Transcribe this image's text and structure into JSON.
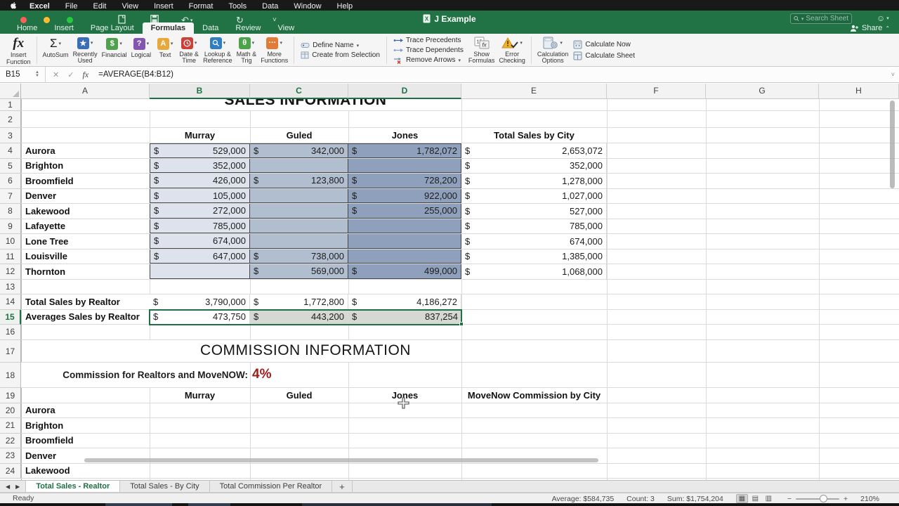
{
  "menu_bar": {
    "items": [
      "Excel",
      "File",
      "Edit",
      "View",
      "Insert",
      "Format",
      "Tools",
      "Data",
      "Window",
      "Help"
    ]
  },
  "title_bar": {
    "title": "J Example",
    "search_placeholder": "Search Sheet",
    "share_label": "Share"
  },
  "ribbon_tabs": [
    {
      "label": "Home",
      "active": false
    },
    {
      "label": "Insert",
      "active": false
    },
    {
      "label": "Page Layout",
      "active": false
    },
    {
      "label": "Formulas",
      "active": true
    },
    {
      "label": "Data",
      "active": false
    },
    {
      "label": "Review",
      "active": false
    },
    {
      "label": "View",
      "active": false
    }
  ],
  "ribbon": {
    "insert_function_label": "Insert\nFunction",
    "function_library": [
      {
        "label": "AutoSum",
        "glyph": "Σ",
        "color": "",
        "icon_name": "autosum-icon"
      },
      {
        "label": "Recently\nUsed",
        "glyph": "★",
        "color": "#3a6fb5",
        "icon_name": "recently-used-icon"
      },
      {
        "label": "Financial",
        "glyph": "$",
        "color": "#4fa14d",
        "icon_name": "financial-icon"
      },
      {
        "label": "Logical",
        "glyph": "?",
        "color": "#8456b0",
        "icon_name": "logical-icon"
      },
      {
        "label": "Text",
        "glyph": "A",
        "color": "#e9a93a",
        "icon_name": "text-icon"
      },
      {
        "label": "Date &\nTime",
        "glyph": "clock",
        "color": "#cc4038",
        "icon_name": "date-time-icon"
      },
      {
        "label": "Lookup &\nReference",
        "glyph": "mag",
        "color": "#2f7ec1",
        "icon_name": "lookup-reference-icon"
      },
      {
        "label": "Math &\nTrig",
        "glyph": "θ",
        "color": "#4ca349",
        "icon_name": "math-trig-icon"
      },
      {
        "label": "More\nFunctions",
        "glyph": "···",
        "color": "#e07b39",
        "icon_name": "more-functions-icon"
      }
    ],
    "defined_names": [
      {
        "label": "Define Name",
        "dropdown": true,
        "icon_name": "define-name-icon"
      },
      {
        "label": "Create from Selection",
        "dropdown": false,
        "icon_name": "create-from-selection-icon"
      }
    ],
    "auditing": [
      {
        "label": "Trace Precedents",
        "dropdown": false,
        "icon_name": "trace-precedents-icon"
      },
      {
        "label": "Trace Dependents",
        "dropdown": false,
        "icon_name": "trace-dependents-icon"
      },
      {
        "label": "Remove Arrows",
        "dropdown": true,
        "icon_name": "remove-arrows-icon"
      }
    ],
    "show_formulas_label": "Show\nFormulas",
    "error_checking_label": "Error\nChecking",
    "calculation_options_label": "Calculation\nOptions",
    "calculate": [
      {
        "label": "Calculate Now",
        "icon_name": "calculate-now-icon"
      },
      {
        "label": "Calculate Sheet",
        "icon_name": "calculate-sheet-icon"
      }
    ]
  },
  "formula_bar": {
    "name_box": "B15",
    "cancel": "✕",
    "enter": "✓",
    "fx": "fx",
    "formula": "=AVERAGE(B4:B12)"
  },
  "grid": {
    "columns": [
      "A",
      "B",
      "C",
      "D",
      "E",
      "F",
      "G",
      "H"
    ],
    "selected_columns": [
      "B",
      "C",
      "D"
    ],
    "selected_row": 15,
    "active_cell": "B15",
    "rows": [
      {
        "n": 1,
        "type": "big-title",
        "title": "SALES INFORMATION"
      },
      {
        "n": 2,
        "type": "empty"
      },
      {
        "n": 3,
        "type": "col-headers",
        "b": "Murray",
        "c": "Guled",
        "d": "Jones",
        "e": "Total Sales by City"
      },
      {
        "n": 4,
        "type": "data",
        "a": "Aurora",
        "b": "529,000",
        "c": "342,000",
        "d": "1,782,072",
        "e": "2,653,072"
      },
      {
        "n": 5,
        "type": "data",
        "a": "Brighton",
        "b": "352,000",
        "c": "",
        "d": "",
        "e": "352,000"
      },
      {
        "n": 6,
        "type": "data",
        "a": "Broomfield",
        "b": "426,000",
        "c": "123,800",
        "d": "728,200",
        "e": "1,278,000"
      },
      {
        "n": 7,
        "type": "data",
        "a": "Denver",
        "b": "105,000",
        "c": "",
        "d": "922,000",
        "e": "1,027,000"
      },
      {
        "n": 8,
        "type": "data",
        "a": "Lakewood",
        "b": "272,000",
        "c": "",
        "d": "255,000",
        "e": "527,000"
      },
      {
        "n": 9,
        "type": "data",
        "a": "Lafayette",
        "b": "785,000",
        "c": "",
        "d": "",
        "e": "785,000"
      },
      {
        "n": 10,
        "type": "data",
        "a": "Lone Tree",
        "b": "674,000",
        "c": "",
        "d": "",
        "e": "674,000"
      },
      {
        "n": 11,
        "type": "data",
        "a": "Louisville",
        "b": "647,000",
        "c": "738,000",
        "d": "",
        "e": "1,385,000"
      },
      {
        "n": 12,
        "type": "data",
        "a": "Thornton",
        "b": "",
        "c": "569,000",
        "d": "499,000",
        "e": "1,068,000"
      },
      {
        "n": 13,
        "type": "empty"
      },
      {
        "n": 14,
        "type": "totals",
        "a": "Total Sales by Realtor",
        "b": "3,790,000",
        "c": "1,772,800",
        "d": "4,186,272"
      },
      {
        "n": 15,
        "type": "averages",
        "a": "Averages Sales by Realtor",
        "b": "473,750",
        "c": "443,200",
        "d": "837,254"
      },
      {
        "n": 16,
        "type": "empty"
      },
      {
        "n": 17,
        "type": "big-title",
        "title": "COMMISSION INFORMATION"
      },
      {
        "n": 18,
        "type": "rate",
        "label": "Commission for Realtors and MoveNOW:",
        "rate": "4%",
        "rate_color": "#9e1b1b"
      },
      {
        "n": 19,
        "type": "col-headers",
        "b": "Murray",
        "c": "Guled",
        "d": "Jones",
        "e": "MoveNow Commission by City"
      },
      {
        "n": 20,
        "type": "label-only",
        "a": "Aurora"
      },
      {
        "n": 21,
        "type": "label-only",
        "a": "Brighton"
      },
      {
        "n": 22,
        "type": "label-only",
        "a": "Broomfield"
      },
      {
        "n": 23,
        "type": "label-only",
        "a": "Denver"
      },
      {
        "n": 24,
        "type": "label-only",
        "a": "Lakewood"
      }
    ],
    "currency_symbol": "$"
  },
  "sheet_tabs": {
    "tabs": [
      {
        "label": "Total Sales - Realtor",
        "active": true
      },
      {
        "label": "Total Sales - By City",
        "active": false
      },
      {
        "label": "Total Commission Per Realtor",
        "active": false
      }
    ],
    "add_label": "+"
  },
  "status_bar": {
    "ready": "Ready",
    "average": "Average: $584,735",
    "count": "Count: 3",
    "sum": "Sum: $1,754,204",
    "zoom": "210%"
  },
  "colors": {
    "brand_green": "#217346",
    "fill_b": "#dde2ec",
    "fill_c": "#b1bed0",
    "fill_d": "#8ea0bb",
    "selection_gray": "#d6d8d4",
    "rate_red": "#9e1b1b"
  }
}
